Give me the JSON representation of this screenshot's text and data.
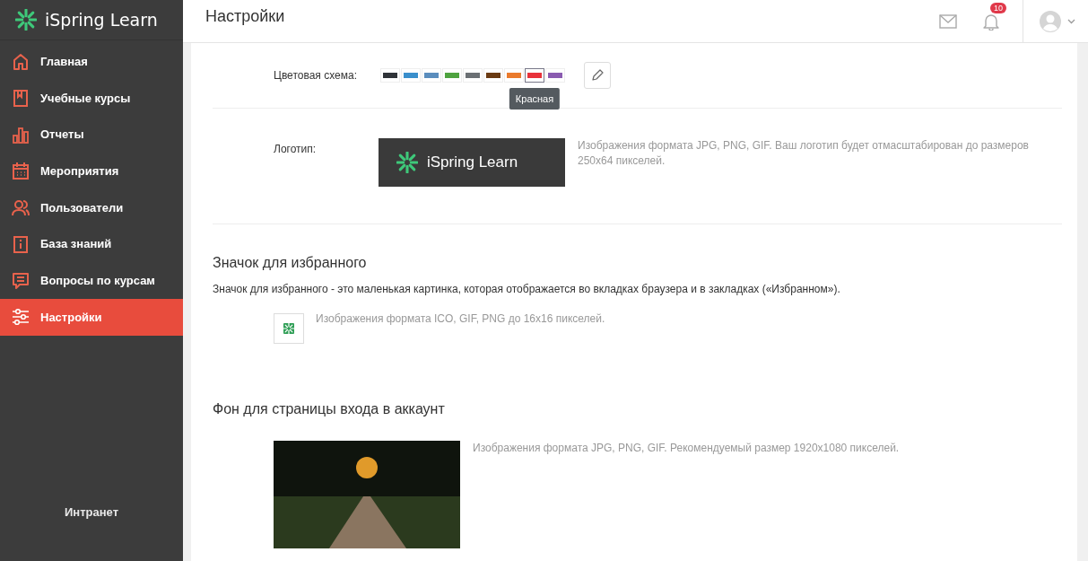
{
  "sidebar": {
    "brand": "iSpring Learn",
    "items": [
      {
        "label": "Главная",
        "selected": false
      },
      {
        "label": "Учебные курсы",
        "selected": false
      },
      {
        "label": "Отчеты",
        "selected": false
      },
      {
        "label": "Мероприятия",
        "selected": false
      },
      {
        "label": "Пользователи",
        "selected": false
      },
      {
        "label": "База знаний",
        "selected": false
      },
      {
        "label": "Вопросы по курсам",
        "selected": false
      },
      {
        "label": "Настройки",
        "selected": true
      }
    ],
    "footer": "Интранет"
  },
  "header": {
    "title": "Настройки",
    "notifications": "10"
  },
  "color_scheme": {
    "label": "Цветовая схема:",
    "tooltip": "Красная",
    "swatches": [
      {
        "color": "#2f3338",
        "selected": false
      },
      {
        "color": "#3a8fcc",
        "selected": false
      },
      {
        "color": "#5a8dbd",
        "selected": false
      },
      {
        "color": "#4ea33f",
        "selected": false
      },
      {
        "color": "#6b7074",
        "selected": false
      },
      {
        "color": "#6a3a12",
        "selected": false
      },
      {
        "color": "#ea7a2c",
        "selected": false
      },
      {
        "color": "#e8323a",
        "selected": true
      },
      {
        "color": "#8a5bb0",
        "selected": false
      }
    ]
  },
  "logo": {
    "label": "Логотип:",
    "preview_text": "iSpring Learn",
    "hint": "Изображения формата JPG, PNG, GIF. Ваш логотип будет отмасштабирован до размеров 250x64 пикселей."
  },
  "favicon": {
    "heading": "Значок для избранного",
    "description": "Значок для избранного - это маленькая картинка, которая отображается во вкладках браузера и в закладках («Избранном»).",
    "hint": "Изображения формата ICO, GIF, PNG до 16x16 пикселей."
  },
  "login_background": {
    "heading": "Фон для страницы входа в аккаунт",
    "hint": "Изображения формата JPG, PNG, GIF. Рекомендуемый размер 1920x1080 пикселей."
  }
}
